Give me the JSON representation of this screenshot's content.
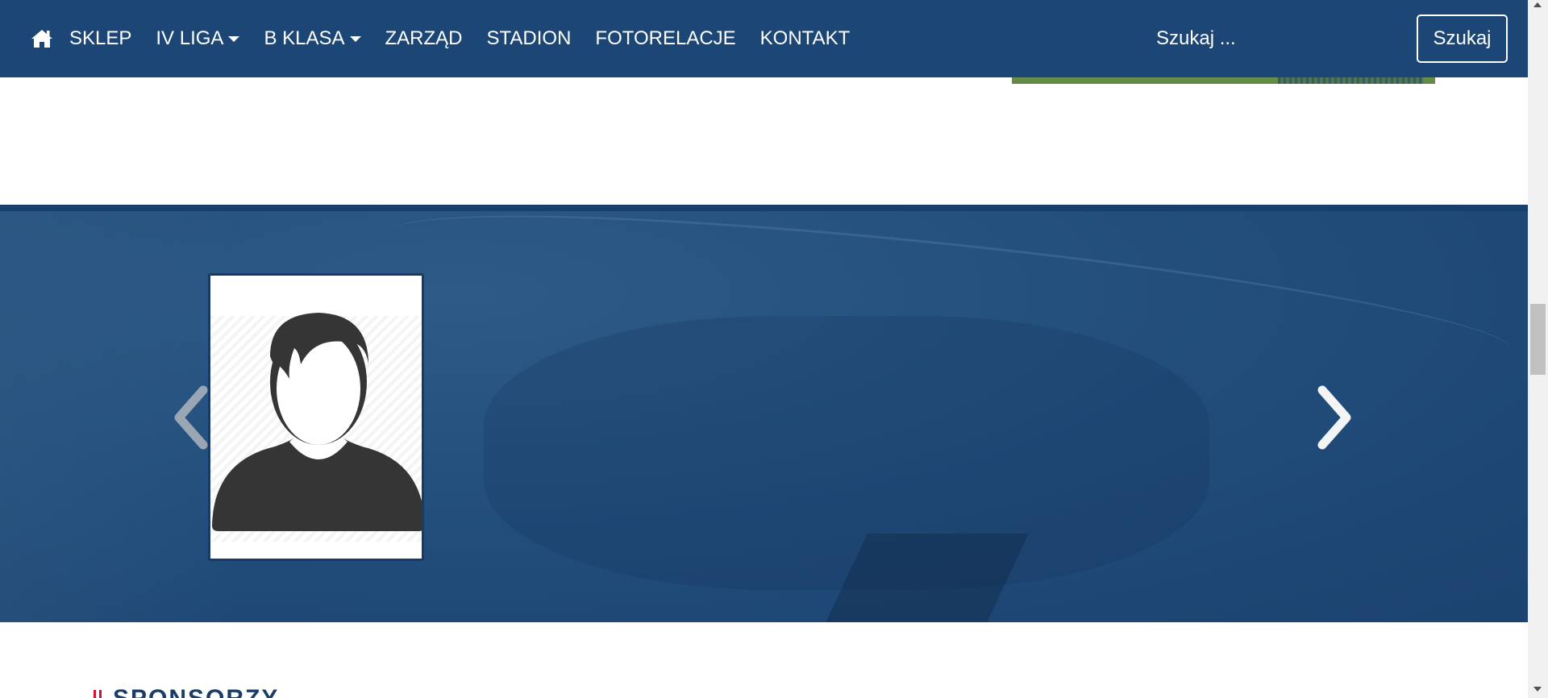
{
  "nav": {
    "home_icon": "home-icon",
    "items": [
      {
        "label": "SKLEP",
        "dropdown": false
      },
      {
        "label": "IV LIGA",
        "dropdown": true
      },
      {
        "label": "B KLASA",
        "dropdown": true
      },
      {
        "label": "ZARZĄD",
        "dropdown": false
      },
      {
        "label": "STADION",
        "dropdown": false
      },
      {
        "label": "FOTORELACJE",
        "dropdown": false
      },
      {
        "label": "KONTAKT",
        "dropdown": false
      }
    ],
    "search_placeholder": "Szukaj ...",
    "search_button": "Szukaj",
    "colors": {
      "navbar": "#1c4675",
      "text": "#ffffff"
    }
  },
  "carousel": {
    "prev_icon": "chevron-left-icon",
    "next_icon": "chevron-right-icon",
    "player_image_icon": "person-silhouette-icon"
  },
  "sponsors": {
    "title": "SPONSORZY",
    "accent_color": "#d2122e"
  }
}
